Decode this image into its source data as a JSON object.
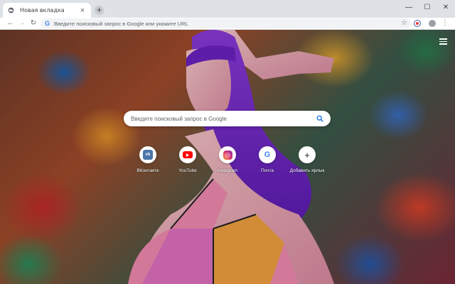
{
  "tab": {
    "title": "Новая вкладка",
    "close": "×",
    "icon": "globe-icon"
  },
  "newtab": {
    "label": "+"
  },
  "window": {
    "minimize": "—",
    "maximize": "☐",
    "close": "✕"
  },
  "nav": {
    "back": "←",
    "forward": "→",
    "reload": "↻"
  },
  "omnibox": {
    "g": "G",
    "placeholder": "Введите поисковый запрос в Google или укажите URL",
    "star": "☆"
  },
  "menu": {
    "dots": "⋮"
  },
  "search": {
    "placeholder": "Введите поисковый запрос в Google",
    "icon": "search-icon",
    "color": "#1a73e8"
  },
  "shortcuts": [
    {
      "label": "ВКонтакте",
      "glyph": "vk",
      "icon": "vk-icon",
      "color": "#4a76a8"
    },
    {
      "label": "YouTube",
      "glyph": "▶",
      "icon": "youtube-icon",
      "color": "#ff0000"
    },
    {
      "label": "Instagram",
      "glyph": "◎",
      "icon": "instagram-icon",
      "color": "#c13584"
    },
    {
      "label": "Почта",
      "glyph": "G",
      "icon": "google-icon",
      "color": "#4285f4"
    },
    {
      "label": "Добавить ярлык",
      "glyph": "+",
      "icon": "plus-icon",
      "color": "#202124"
    }
  ]
}
